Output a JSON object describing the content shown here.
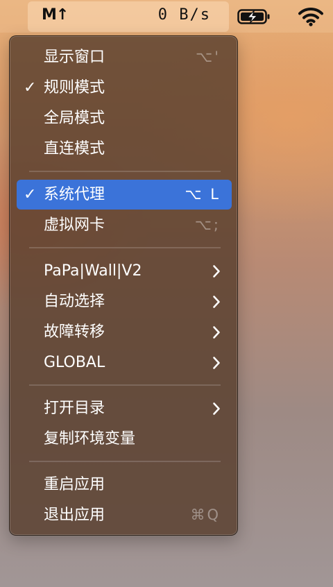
{
  "menubar": {
    "app_logo": "M↑",
    "speed": "0 B/s",
    "battery_icon": "battery-charging-icon",
    "wifi_icon": "wifi-icon"
  },
  "menu": {
    "items": [
      {
        "label": "显示窗口",
        "shortcut": "⌥'",
        "checked": false
      },
      {
        "label": "规则模式",
        "checked": true
      },
      {
        "label": "全局模式",
        "checked": false
      },
      {
        "label": "直连模式",
        "checked": false
      },
      {
        "label": "系统代理",
        "shortcut": "⌥ L",
        "checked": true,
        "highlighted": true
      },
      {
        "label": "虚拟网卡",
        "shortcut": "⌥;",
        "checked": false
      },
      {
        "label": "PaPa|Wall|V2",
        "submenu": true
      },
      {
        "label": "自动选择",
        "submenu": true
      },
      {
        "label": "故障转移",
        "submenu": true
      },
      {
        "label": "GLOBAL",
        "submenu": true
      },
      {
        "label": "打开目录",
        "submenu": true
      },
      {
        "label": "复制环境变量"
      },
      {
        "label": "重启应用"
      },
      {
        "label": "退出应用",
        "shortcut": "⌘Q"
      }
    ],
    "check_glyph": "✓"
  },
  "colors": {
    "highlight": "#3b73d9",
    "menu_background": "#583e2d"
  }
}
